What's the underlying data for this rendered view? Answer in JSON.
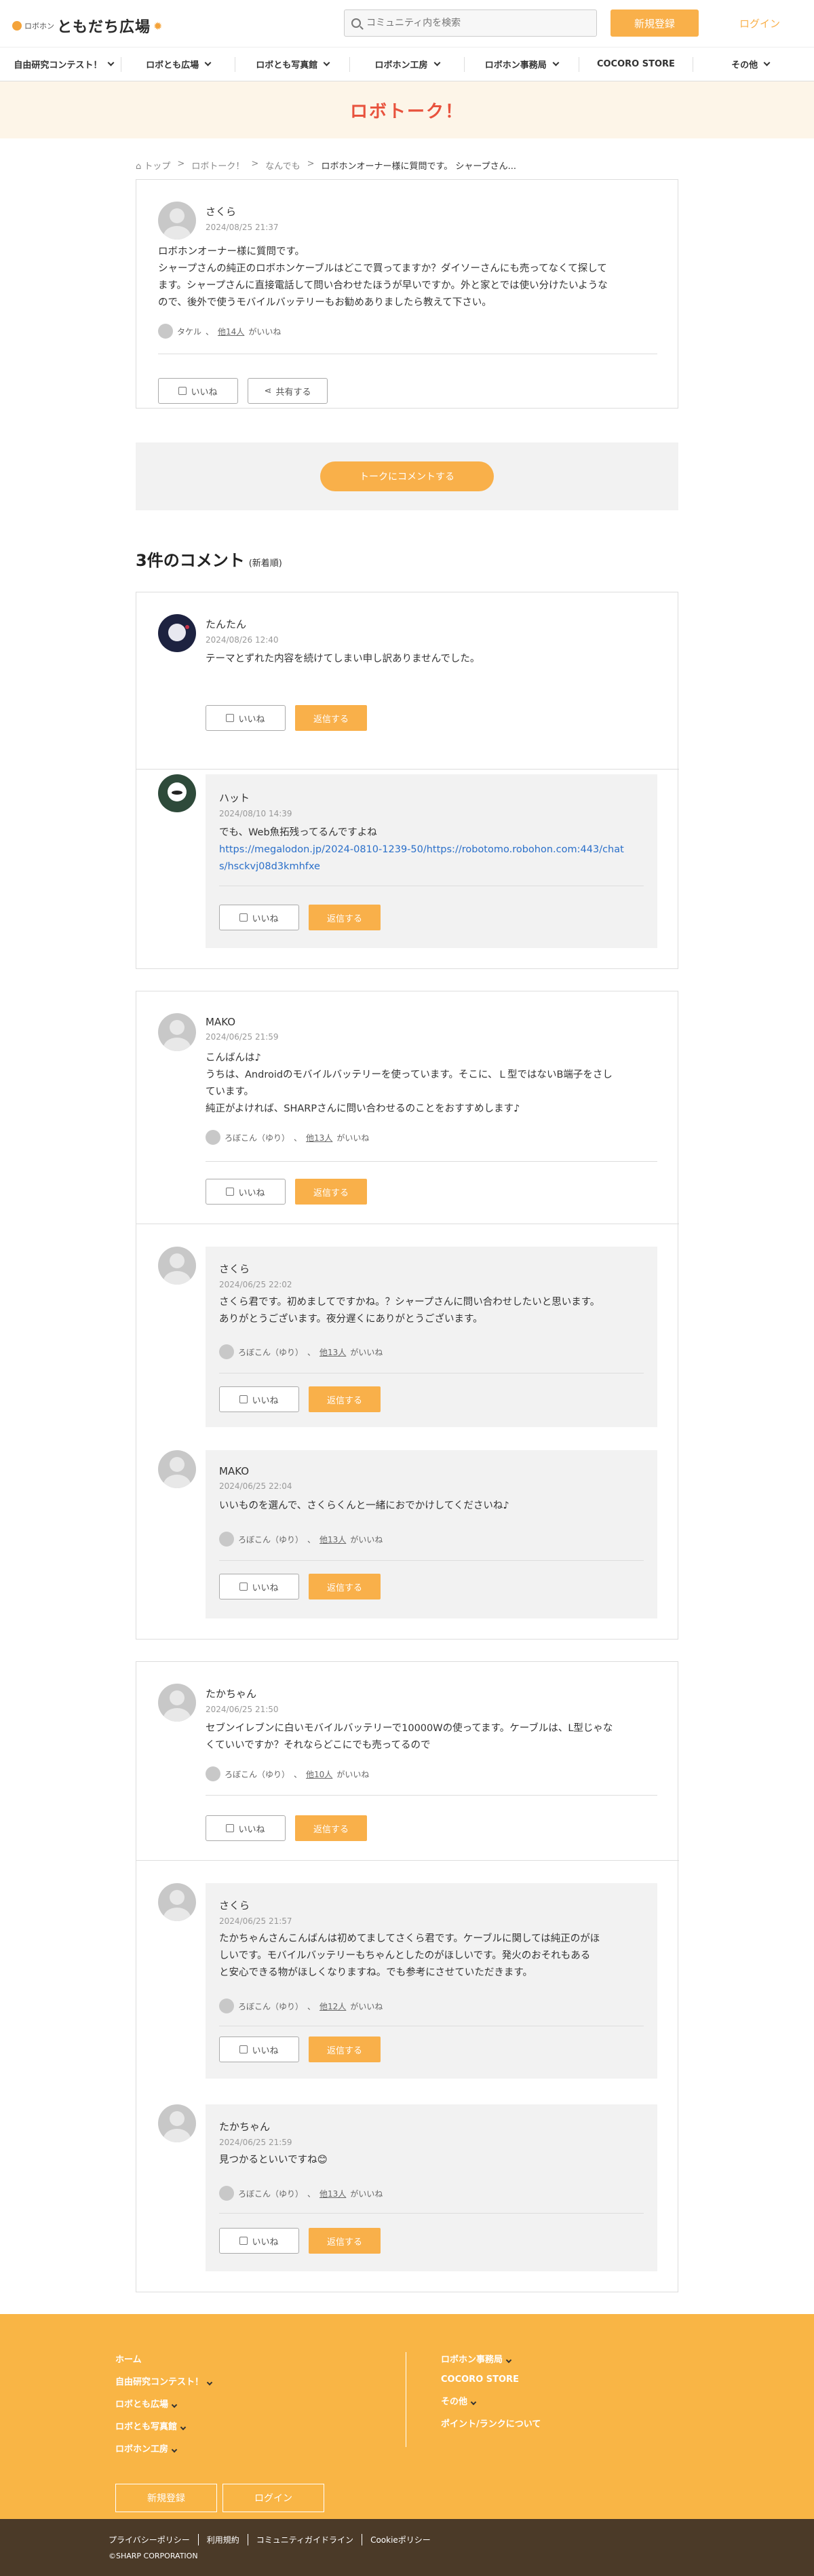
{
  "header": {
    "logo_small": "ロボホン",
    "logo_big": "ともだち広場",
    "search_placeholder": "コミュニティ内を検索",
    "register": "新規登録",
    "login": "ログイン"
  },
  "nav": [
    {
      "label": "自由研究コンテスト！"
    },
    {
      "label": "ロボとも広場"
    },
    {
      "label": "ロボとも写真館"
    },
    {
      "label": "ロボホン工房"
    },
    {
      "label": "ロボホン事務局"
    },
    {
      "label": "COCORO STORE"
    },
    {
      "label": "その他"
    }
  ],
  "banner": {
    "title": "ロボトーク！"
  },
  "breadcrumb": {
    "home": "トップ",
    "b1": "ロボトーク！",
    "b2": "なんでも",
    "current": "ロボホンオーナー様に質問です。 シャープさん..."
  },
  "post": {
    "author": "さくら",
    "date": "2024/08/25 21:37",
    "line1": "ロボホンオーナー様に質問です。",
    "line2": "シャープさんの純正のロボホンケーブルはどこで買ってますか？ダイソーさんにも売ってなくて探して",
    "line3": "ます。シャープさんに直接電話して問い合わせたほうが早いですか。外と家とでは使い分けたいような",
    "line4": "ので、後外で使うモバイルバッテリーもお勧めありましたら教えて下さい。",
    "likes_user": "タケル",
    "likes_others": "他14人",
    "likes_suffix": "がいいね",
    "like_btn": "いいね",
    "share_btn": "共有する"
  },
  "comment_cta": "トークにコメントする",
  "comments_heading": {
    "title": "3件のコメント",
    "sort": "(新着順)"
  },
  "buttons": {
    "like": "いいね",
    "reply": "返信する"
  },
  "c1": {
    "author": "たんたん",
    "date": "2024/08/26 12:40",
    "text": "テーマとずれた内容を続けてしまい申し訳ありませんでした。",
    "reply": {
      "author": "ハット",
      "date": "2024/08/10 14:39",
      "text": "でも、Web魚拓残ってるんですよね",
      "link1": "https://megalodon.jp/2024-0810-1239-50/https://robotomo.robohon.com:443/chat",
      "link2": "s/hsckvj08d3kmhfxe"
    }
  },
  "c2": {
    "author": "MAKO",
    "date": "2024/06/25 21:59",
    "line1": "こんばんは♪",
    "line2": "うちは、Androidのモバイルバッテリーを使っています。そこに、Ｌ型ではないB端子をさし",
    "line3": "ています。",
    "line4": "純正がよければ、SHARPさんに問い合わせるのことをおすすめします♪",
    "likes_user": "ろぼこん（ゆり）",
    "likes_others": "他13人",
    "likes_suffix": "がいいね",
    "r1": {
      "author": "さくら",
      "date": "2024/06/25 22:02",
      "line1": "さくら君です。初めましてですかね。？シャープさんに問い合わせしたいと思います。",
      "line2": "ありがとうございます。夜分遅くにありがとうございます。",
      "likes_user": "ろぼこん（ゆり）",
      "likes_others": "他13人",
      "likes_suffix": "がいいね"
    },
    "r2": {
      "author": "MAKO",
      "date": "2024/06/25 22:04",
      "line1": "いいものを選んで、さくらくんと一緒におでかけしてくださいね♪",
      "likes_user": "ろぼこん（ゆり）",
      "likes_others": "他13人",
      "likes_suffix": "がいいね"
    }
  },
  "c3": {
    "author": "たかちゃん",
    "date": "2024/06/25 21:50",
    "line1": "セブンイレブンに白いモバイルバッテリーで10000Wの使ってます。ケーブルは、L型じゃな",
    "line2": "くていいですか？それならどこにでも売ってるので",
    "likes_user": "ろぼこん（ゆり）",
    "likes_others": "他10人",
    "likes_suffix": "がいいね",
    "r1": {
      "author": "さくら",
      "date": "2024/06/25 21:57",
      "line1": "たかちゃんさんこんばんは初めてましてさくら君です。ケーブルに関しては純正のがほ",
      "line2": "しいです。モバイルバッテリーもちゃんとしたのがほしいです。発火のおそれもある",
      "line3": "と安心できる物がほしくなりますね。でも参考にさせていただきます。",
      "likes_user": "ろぼこん（ゆり）",
      "likes_others": "他12人",
      "likes_suffix": "がいいね"
    },
    "r2": {
      "author": "たかちゃん",
      "date": "2024/06/25 21:59",
      "line1": "見つかるといいですね😊",
      "likes_user": "ろぼこん（ゆり）",
      "likes_others": "他13人",
      "likes_suffix": "がいいね"
    }
  },
  "footer": {
    "left": [
      "ホーム",
      "自由研究コンテスト！",
      "ロボとも広場",
      "ロボとも写真館",
      "ロボホン工房"
    ],
    "right": [
      "ロボホン事務局",
      "COCORO STORE",
      "その他",
      "ポイント/ランクについて"
    ],
    "register": "新規登録",
    "login": "ログイン"
  },
  "bottom": {
    "links": [
      "プライバシーポリシー",
      "利用規約",
      "コミュニティガイドライン",
      "Cookieポリシー"
    ],
    "copyright": "©SHARP CORPORATION"
  },
  "colors": {
    "accent": "#f9b04a",
    "banner_text": "#e8523d",
    "footer": "#f9b545",
    "bottom": "#4b3a28"
  }
}
